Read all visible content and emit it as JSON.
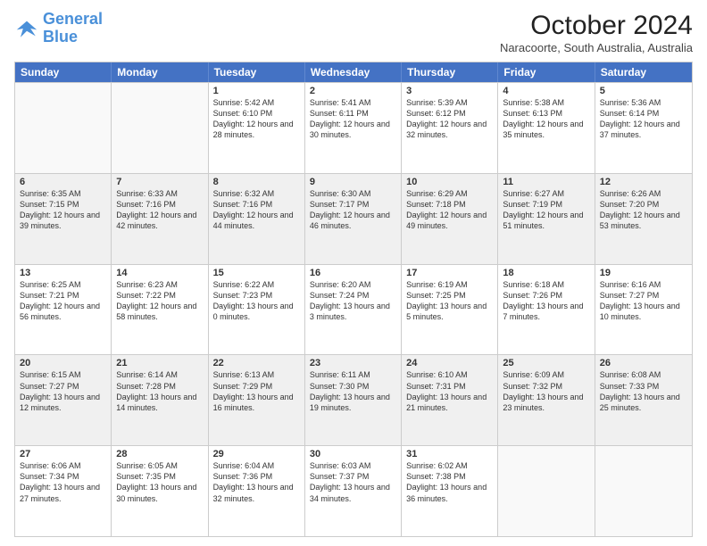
{
  "header": {
    "logo_general": "General",
    "logo_blue": "Blue",
    "month_year": "October 2024",
    "location": "Naracoorte, South Australia, Australia"
  },
  "days_of_week": [
    "Sunday",
    "Monday",
    "Tuesday",
    "Wednesday",
    "Thursday",
    "Friday",
    "Saturday"
  ],
  "weeks": [
    [
      {
        "day": "",
        "info": "",
        "empty": true
      },
      {
        "day": "",
        "info": "",
        "empty": true
      },
      {
        "day": "1",
        "info": "Sunrise: 5:42 AM\nSunset: 6:10 PM\nDaylight: 12 hours and 28 minutes."
      },
      {
        "day": "2",
        "info": "Sunrise: 5:41 AM\nSunset: 6:11 PM\nDaylight: 12 hours and 30 minutes."
      },
      {
        "day": "3",
        "info": "Sunrise: 5:39 AM\nSunset: 6:12 PM\nDaylight: 12 hours and 32 minutes."
      },
      {
        "day": "4",
        "info": "Sunrise: 5:38 AM\nSunset: 6:13 PM\nDaylight: 12 hours and 35 minutes."
      },
      {
        "day": "5",
        "info": "Sunrise: 5:36 AM\nSunset: 6:14 PM\nDaylight: 12 hours and 37 minutes."
      }
    ],
    [
      {
        "day": "6",
        "info": "Sunrise: 6:35 AM\nSunset: 7:15 PM\nDaylight: 12 hours and 39 minutes."
      },
      {
        "day": "7",
        "info": "Sunrise: 6:33 AM\nSunset: 7:16 PM\nDaylight: 12 hours and 42 minutes."
      },
      {
        "day": "8",
        "info": "Sunrise: 6:32 AM\nSunset: 7:16 PM\nDaylight: 12 hours and 44 minutes."
      },
      {
        "day": "9",
        "info": "Sunrise: 6:30 AM\nSunset: 7:17 PM\nDaylight: 12 hours and 46 minutes."
      },
      {
        "day": "10",
        "info": "Sunrise: 6:29 AM\nSunset: 7:18 PM\nDaylight: 12 hours and 49 minutes."
      },
      {
        "day": "11",
        "info": "Sunrise: 6:27 AM\nSunset: 7:19 PM\nDaylight: 12 hours and 51 minutes."
      },
      {
        "day": "12",
        "info": "Sunrise: 6:26 AM\nSunset: 7:20 PM\nDaylight: 12 hours and 53 minutes."
      }
    ],
    [
      {
        "day": "13",
        "info": "Sunrise: 6:25 AM\nSunset: 7:21 PM\nDaylight: 12 hours and 56 minutes."
      },
      {
        "day": "14",
        "info": "Sunrise: 6:23 AM\nSunset: 7:22 PM\nDaylight: 12 hours and 58 minutes."
      },
      {
        "day": "15",
        "info": "Sunrise: 6:22 AM\nSunset: 7:23 PM\nDaylight: 13 hours and 0 minutes."
      },
      {
        "day": "16",
        "info": "Sunrise: 6:20 AM\nSunset: 7:24 PM\nDaylight: 13 hours and 3 minutes."
      },
      {
        "day": "17",
        "info": "Sunrise: 6:19 AM\nSunset: 7:25 PM\nDaylight: 13 hours and 5 minutes."
      },
      {
        "day": "18",
        "info": "Sunrise: 6:18 AM\nSunset: 7:26 PM\nDaylight: 13 hours and 7 minutes."
      },
      {
        "day": "19",
        "info": "Sunrise: 6:16 AM\nSunset: 7:27 PM\nDaylight: 13 hours and 10 minutes."
      }
    ],
    [
      {
        "day": "20",
        "info": "Sunrise: 6:15 AM\nSunset: 7:27 PM\nDaylight: 13 hours and 12 minutes."
      },
      {
        "day": "21",
        "info": "Sunrise: 6:14 AM\nSunset: 7:28 PM\nDaylight: 13 hours and 14 minutes."
      },
      {
        "day": "22",
        "info": "Sunrise: 6:13 AM\nSunset: 7:29 PM\nDaylight: 13 hours and 16 minutes."
      },
      {
        "day": "23",
        "info": "Sunrise: 6:11 AM\nSunset: 7:30 PM\nDaylight: 13 hours and 19 minutes."
      },
      {
        "day": "24",
        "info": "Sunrise: 6:10 AM\nSunset: 7:31 PM\nDaylight: 13 hours and 21 minutes."
      },
      {
        "day": "25",
        "info": "Sunrise: 6:09 AM\nSunset: 7:32 PM\nDaylight: 13 hours and 23 minutes."
      },
      {
        "day": "26",
        "info": "Sunrise: 6:08 AM\nSunset: 7:33 PM\nDaylight: 13 hours and 25 minutes."
      }
    ],
    [
      {
        "day": "27",
        "info": "Sunrise: 6:06 AM\nSunset: 7:34 PM\nDaylight: 13 hours and 27 minutes."
      },
      {
        "day": "28",
        "info": "Sunrise: 6:05 AM\nSunset: 7:35 PM\nDaylight: 13 hours and 30 minutes."
      },
      {
        "day": "29",
        "info": "Sunrise: 6:04 AM\nSunset: 7:36 PM\nDaylight: 13 hours and 32 minutes."
      },
      {
        "day": "30",
        "info": "Sunrise: 6:03 AM\nSunset: 7:37 PM\nDaylight: 13 hours and 34 minutes."
      },
      {
        "day": "31",
        "info": "Sunrise: 6:02 AM\nSunset: 7:38 PM\nDaylight: 13 hours and 36 minutes."
      },
      {
        "day": "",
        "info": "",
        "empty": true
      },
      {
        "day": "",
        "info": "",
        "empty": true
      }
    ]
  ]
}
